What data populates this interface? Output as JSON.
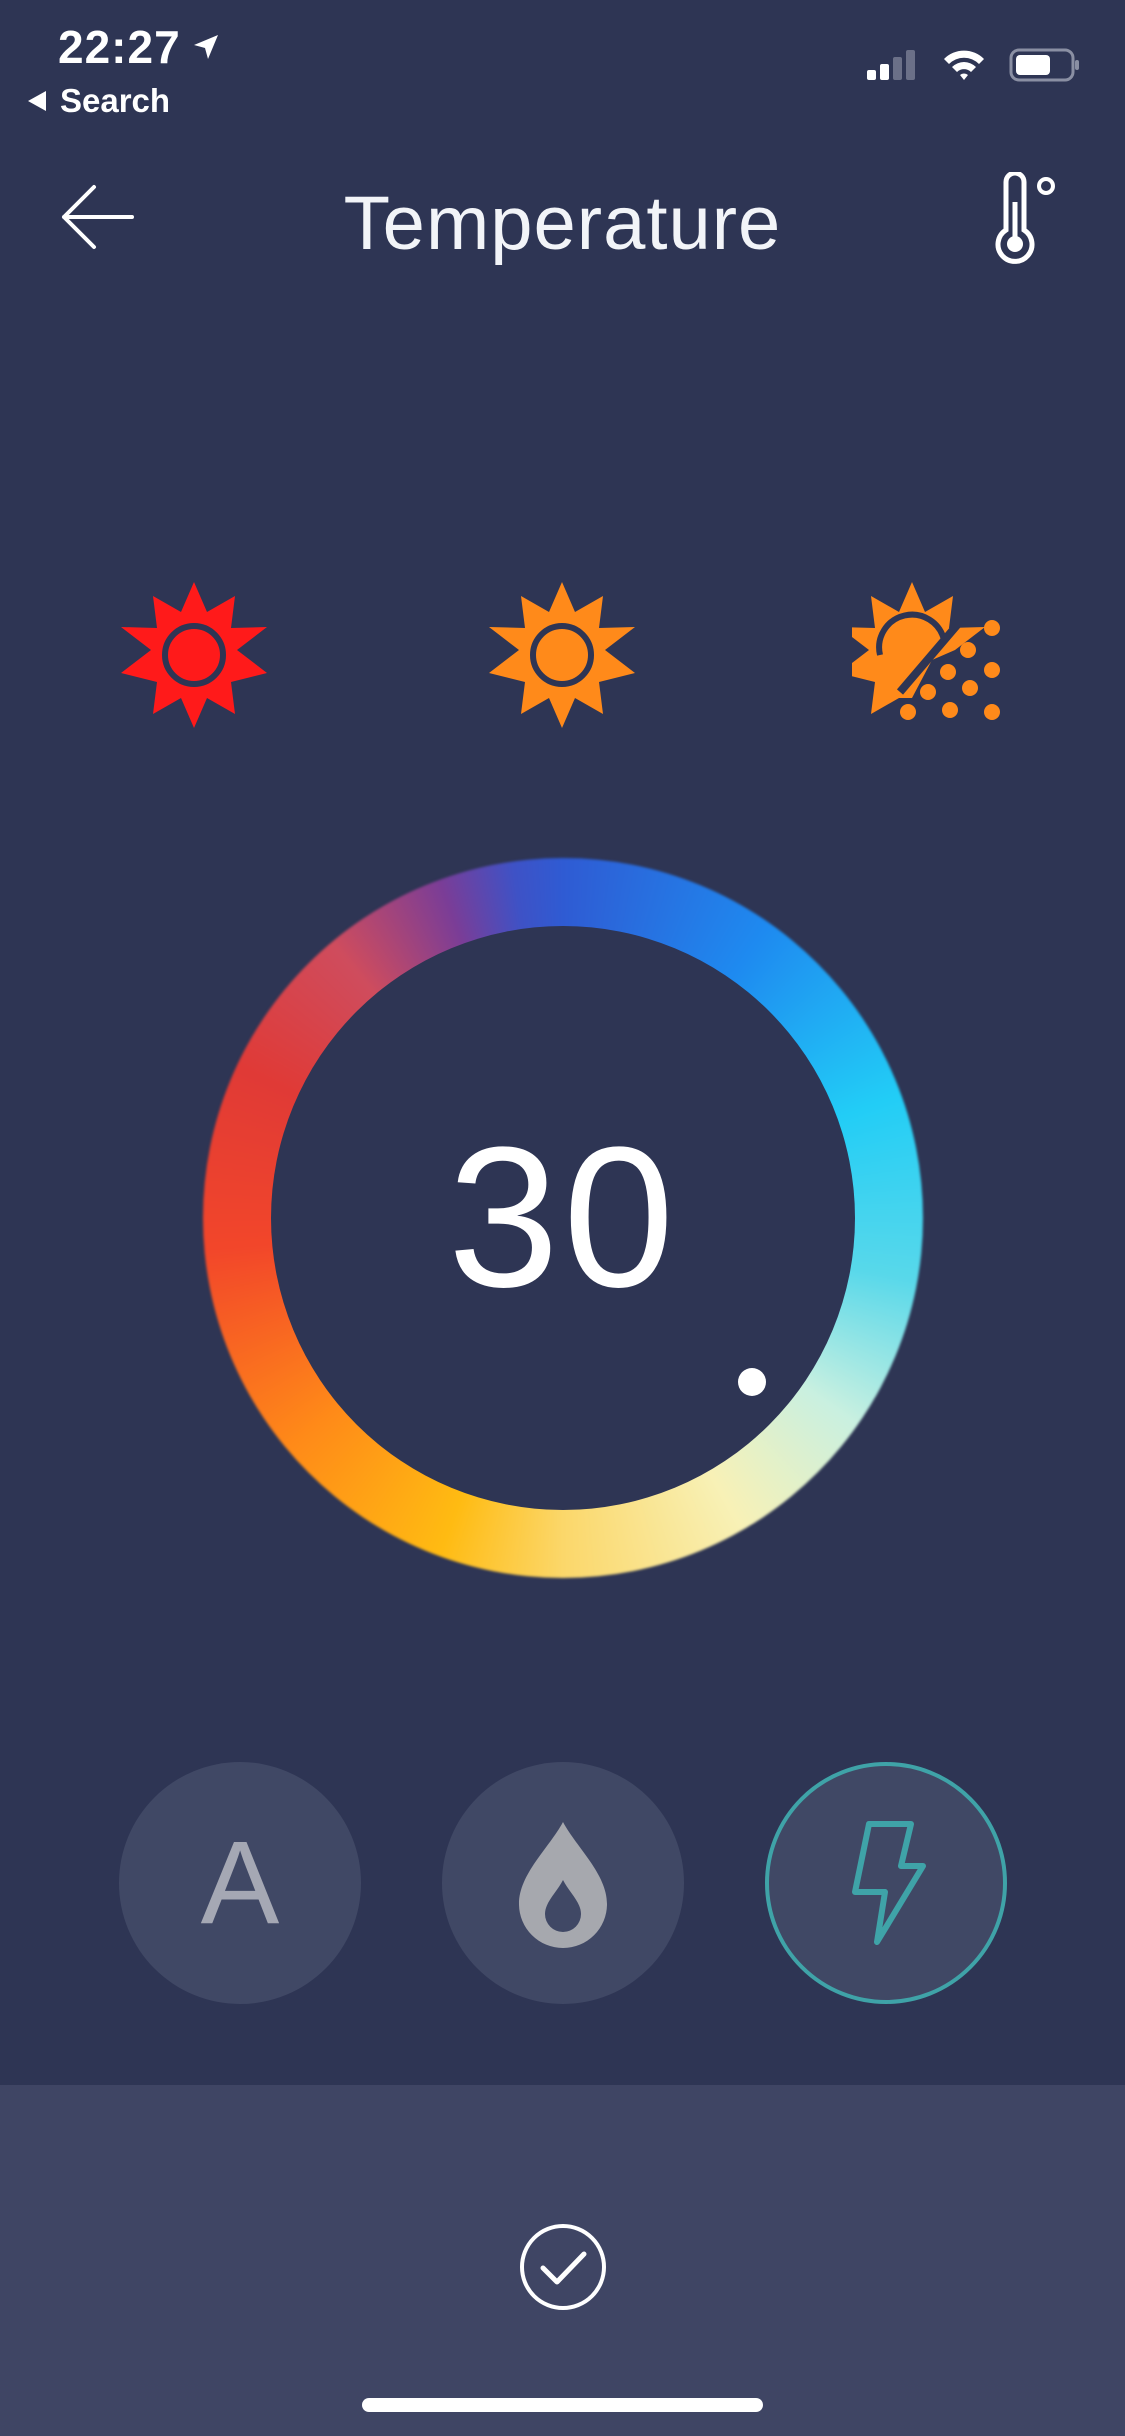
{
  "status_bar": {
    "time": "22:27",
    "back_app_label": "Search",
    "icons": [
      "location-arrow-icon",
      "signal-icon",
      "wifi-icon",
      "battery-icon"
    ]
  },
  "nav": {
    "title": "Temperature",
    "back_icon": "arrow-left-icon",
    "unit_icon": "thermometer-degree-icon"
  },
  "modes": [
    {
      "name": "hot",
      "icon": "sun-icon",
      "color": "#ff1a1a"
    },
    {
      "name": "warm",
      "icon": "sun-icon",
      "color": "#ff8a1a"
    },
    {
      "name": "mild",
      "icon": "sun-dots-icon",
      "color": "#ff8a1a"
    }
  ],
  "dial": {
    "value": "30"
  },
  "options": [
    {
      "label": "A",
      "icon": "auto-letter",
      "selected": false
    },
    {
      "label": "",
      "icon": "drop-icon",
      "selected": false
    },
    {
      "label": "",
      "icon": "lightning-icon",
      "selected": true
    }
  ],
  "colors": {
    "background": "#2e3554",
    "bottom_bar": "#3f4564",
    "button_bg": "#404865",
    "accent_teal": "#3fa3a8",
    "hot_red": "#ff1a1a",
    "warm_orange": "#ff8a1a"
  }
}
